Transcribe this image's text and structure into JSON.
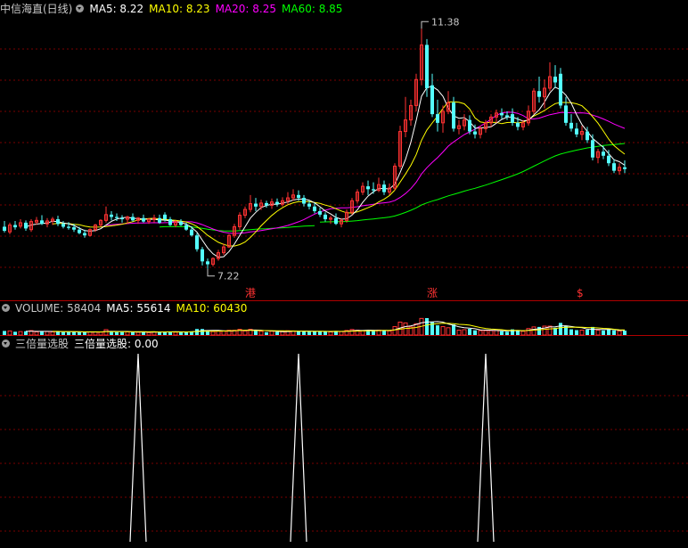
{
  "panels": {
    "price": {
      "stock_name": "中信海直(日线)",
      "ma": [
        {
          "label": "MA5: 8.22",
          "color": "#ffffff"
        },
        {
          "label": "MA10: 8.23",
          "color": "#ffff00"
        },
        {
          "label": "MA20: 8.25",
          "color": "#ff00ff"
        },
        {
          "label": "MA60: 8.85",
          "color": "#00ff00"
        }
      ],
      "high_label": "11.38",
      "low_label": "7.22"
    },
    "volume": {
      "title": "VOLUME: 58404",
      "ma5": "MA5: 55614",
      "ma10": "MA10: 60430"
    },
    "indicator": {
      "name": "三倍量选股",
      "line": "三倍量选股: 0.00"
    }
  },
  "markers": [
    {
      "text": "港",
      "bar": 46
    },
    {
      "text": "涨",
      "bar": 80
    },
    {
      "text": "$",
      "bar": 108
    }
  ],
  "colors": {
    "background": "#000000",
    "up": "#ff3232",
    "down": "#54ffff",
    "grid": "#7a0000",
    "separator": "#b00000",
    "ma5": "#ffffff",
    "ma10": "#ffff00",
    "ma20": "#ff00ff",
    "ma60": "#00ff00"
  },
  "chart_data": {
    "type": "candlestick",
    "price_range": [
      7.0,
      11.6
    ],
    "bars": [
      {
        "o": 7.95,
        "h": 8.05,
        "l": 7.85,
        "c": 7.88
      },
      {
        "o": 7.86,
        "h": 8.02,
        "l": 7.82,
        "c": 7.98
      },
      {
        "o": 7.98,
        "h": 8.05,
        "l": 7.9,
        "c": 7.94
      },
      {
        "o": 7.96,
        "h": 8.08,
        "l": 7.92,
        "c": 8.02
      },
      {
        "o": 8.02,
        "h": 8.06,
        "l": 7.88,
        "c": 7.92
      },
      {
        "o": 7.9,
        "h": 8.08,
        "l": 7.86,
        "c": 8.04
      },
      {
        "o": 8.03,
        "h": 8.12,
        "l": 7.98,
        "c": 8.06
      },
      {
        "o": 8.06,
        "h": 8.15,
        "l": 7.98,
        "c": 8.0
      },
      {
        "o": 8.0,
        "h": 8.1,
        "l": 7.94,
        "c": 8.05
      },
      {
        "o": 8.05,
        "h": 8.12,
        "l": 7.98,
        "c": 8.08
      },
      {
        "o": 8.08,
        "h": 8.14,
        "l": 7.96,
        "c": 8.0
      },
      {
        "o": 8.0,
        "h": 8.05,
        "l": 7.92,
        "c": 7.95
      },
      {
        "o": 7.95,
        "h": 8.03,
        "l": 7.9,
        "c": 7.93
      },
      {
        "o": 7.94,
        "h": 8.0,
        "l": 7.86,
        "c": 7.9
      },
      {
        "o": 7.9,
        "h": 7.95,
        "l": 7.82,
        "c": 7.84
      },
      {
        "o": 7.84,
        "h": 7.9,
        "l": 7.76,
        "c": 7.8
      },
      {
        "o": 7.8,
        "h": 7.92,
        "l": 7.78,
        "c": 7.9
      },
      {
        "o": 7.9,
        "h": 8.0,
        "l": 7.86,
        "c": 7.98
      },
      {
        "o": 7.98,
        "h": 8.08,
        "l": 7.95,
        "c": 8.06
      },
      {
        "o": 8.06,
        "h": 8.3,
        "l": 8.02,
        "c": 8.16
      },
      {
        "o": 8.16,
        "h": 8.22,
        "l": 8.06,
        "c": 8.12
      },
      {
        "o": 8.12,
        "h": 8.18,
        "l": 8.05,
        "c": 8.1
      },
      {
        "o": 8.1,
        "h": 8.15,
        "l": 8.02,
        "c": 8.08
      },
      {
        "o": 8.08,
        "h": 8.14,
        "l": 8.0,
        "c": 8.12
      },
      {
        "o": 8.12,
        "h": 8.18,
        "l": 8.04,
        "c": 8.06
      },
      {
        "o": 8.06,
        "h": 8.12,
        "l": 8.0,
        "c": 8.1
      },
      {
        "o": 8.1,
        "h": 8.16,
        "l": 8.02,
        "c": 8.04
      },
      {
        "o": 8.04,
        "h": 8.1,
        "l": 8.0,
        "c": 8.08
      },
      {
        "o": 8.08,
        "h": 8.16,
        "l": 8.02,
        "c": 8.1
      },
      {
        "o": 8.1,
        "h": 8.16,
        "l": 8.0,
        "c": 8.02
      },
      {
        "o": 8.16,
        "h": 8.2,
        "l": 8.04,
        "c": 8.08
      },
      {
        "o": 8.08,
        "h": 8.12,
        "l": 7.96,
        "c": 7.98
      },
      {
        "o": 7.98,
        "h": 8.06,
        "l": 7.94,
        "c": 8.04
      },
      {
        "o": 8.04,
        "h": 8.08,
        "l": 7.96,
        "c": 7.98
      },
      {
        "o": 7.98,
        "h": 8.02,
        "l": 7.88,
        "c": 7.9
      },
      {
        "o": 7.9,
        "h": 7.96,
        "l": 7.78,
        "c": 7.8
      },
      {
        "o": 7.8,
        "h": 7.84,
        "l": 7.52,
        "c": 7.56
      },
      {
        "o": 7.56,
        "h": 7.6,
        "l": 7.28,
        "c": 7.35
      },
      {
        "o": 7.35,
        "h": 7.4,
        "l": 7.22,
        "c": 7.3
      },
      {
        "o": 7.3,
        "h": 7.42,
        "l": 7.26,
        "c": 7.4
      },
      {
        "o": 7.4,
        "h": 7.55,
        "l": 7.36,
        "c": 7.5
      },
      {
        "o": 7.5,
        "h": 7.66,
        "l": 7.46,
        "c": 7.6
      },
      {
        "o": 7.6,
        "h": 7.82,
        "l": 7.58,
        "c": 7.8
      },
      {
        "o": 7.8,
        "h": 8.0,
        "l": 7.76,
        "c": 7.95
      },
      {
        "o": 7.95,
        "h": 8.2,
        "l": 7.9,
        "c": 8.15
      },
      {
        "o": 8.15,
        "h": 8.3,
        "l": 8.1,
        "c": 8.25
      },
      {
        "o": 8.25,
        "h": 8.5,
        "l": 8.2,
        "c": 8.35
      },
      {
        "o": 8.35,
        "h": 8.45,
        "l": 8.22,
        "c": 8.3
      },
      {
        "o": 8.3,
        "h": 8.42,
        "l": 8.24,
        "c": 8.36
      },
      {
        "o": 8.36,
        "h": 8.4,
        "l": 8.28,
        "c": 8.32
      },
      {
        "o": 8.32,
        "h": 8.44,
        "l": 8.26,
        "c": 8.38
      },
      {
        "o": 8.38,
        "h": 8.44,
        "l": 8.3,
        "c": 8.34
      },
      {
        "o": 8.34,
        "h": 8.46,
        "l": 8.3,
        "c": 8.4
      },
      {
        "o": 8.4,
        "h": 8.55,
        "l": 8.34,
        "c": 8.45
      },
      {
        "o": 8.45,
        "h": 8.6,
        "l": 8.4,
        "c": 8.5
      },
      {
        "o": 8.5,
        "h": 8.58,
        "l": 8.4,
        "c": 8.45
      },
      {
        "o": 8.45,
        "h": 8.5,
        "l": 8.3,
        "c": 8.35
      },
      {
        "o": 8.35,
        "h": 8.4,
        "l": 8.25,
        "c": 8.3
      },
      {
        "o": 8.3,
        "h": 8.36,
        "l": 8.18,
        "c": 8.22
      },
      {
        "o": 8.22,
        "h": 8.28,
        "l": 8.12,
        "c": 8.16
      },
      {
        "o": 8.16,
        "h": 8.2,
        "l": 8.04,
        "c": 8.08
      },
      {
        "o": 8.08,
        "h": 8.14,
        "l": 8.0,
        "c": 8.1
      },
      {
        "o": 8.1,
        "h": 8.18,
        "l": 7.98,
        "c": 8.0
      },
      {
        "o": 8.0,
        "h": 8.1,
        "l": 7.94,
        "c": 8.06
      },
      {
        "o": 8.06,
        "h": 8.25,
        "l": 8.02,
        "c": 8.2
      },
      {
        "o": 8.2,
        "h": 8.45,
        "l": 8.16,
        "c": 8.4
      },
      {
        "o": 8.4,
        "h": 8.6,
        "l": 8.35,
        "c": 8.55
      },
      {
        "o": 8.55,
        "h": 8.72,
        "l": 8.5,
        "c": 8.65
      },
      {
        "o": 8.65,
        "h": 8.75,
        "l": 8.5,
        "c": 8.6
      },
      {
        "o": 8.6,
        "h": 8.72,
        "l": 8.52,
        "c": 8.58
      },
      {
        "o": 8.58,
        "h": 8.8,
        "l": 8.55,
        "c": 8.68
      },
      {
        "o": 8.68,
        "h": 8.75,
        "l": 8.5,
        "c": 8.55
      },
      {
        "o": 8.55,
        "h": 8.7,
        "l": 8.5,
        "c": 8.62
      },
      {
        "o": 8.62,
        "h": 9.05,
        "l": 8.58,
        "c": 9.0
      },
      {
        "o": 9.0,
        "h": 9.7,
        "l": 8.95,
        "c": 9.6
      },
      {
        "o": 9.6,
        "h": 10.2,
        "l": 9.5,
        "c": 9.8
      },
      {
        "o": 9.8,
        "h": 10.15,
        "l": 9.7,
        "c": 10.05
      },
      {
        "o": 10.05,
        "h": 10.6,
        "l": 9.95,
        "c": 10.5
      },
      {
        "o": 10.5,
        "h": 11.38,
        "l": 10.4,
        "c": 11.1
      },
      {
        "o": 11.1,
        "h": 11.2,
        "l": 10.2,
        "c": 10.35
      },
      {
        "o": 10.4,
        "h": 10.6,
        "l": 9.85,
        "c": 9.9
      },
      {
        "o": 9.9,
        "h": 10.15,
        "l": 9.6,
        "c": 9.75
      },
      {
        "o": 9.75,
        "h": 10.05,
        "l": 9.58,
        "c": 9.95
      },
      {
        "o": 9.95,
        "h": 10.3,
        "l": 9.9,
        "c": 10.1
      },
      {
        "o": 10.1,
        "h": 10.2,
        "l": 9.6,
        "c": 9.65
      },
      {
        "o": 9.65,
        "h": 9.8,
        "l": 9.55,
        "c": 9.7
      },
      {
        "o": 9.7,
        "h": 9.9,
        "l": 9.62,
        "c": 9.8
      },
      {
        "o": 9.8,
        "h": 9.88,
        "l": 9.55,
        "c": 9.6
      },
      {
        "o": 9.6,
        "h": 9.72,
        "l": 9.48,
        "c": 9.55
      },
      {
        "o": 9.55,
        "h": 9.7,
        "l": 9.48,
        "c": 9.65
      },
      {
        "o": 9.65,
        "h": 9.8,
        "l": 9.58,
        "c": 9.75
      },
      {
        "o": 9.75,
        "h": 9.9,
        "l": 9.68,
        "c": 9.85
      },
      {
        "o": 9.85,
        "h": 9.98,
        "l": 9.75,
        "c": 9.92
      },
      {
        "o": 9.92,
        "h": 10.0,
        "l": 9.82,
        "c": 9.88
      },
      {
        "o": 9.88,
        "h": 9.95,
        "l": 9.8,
        "c": 9.85
      },
      {
        "o": 9.9,
        "h": 10.0,
        "l": 9.7,
        "c": 9.75
      },
      {
        "o": 9.75,
        "h": 9.85,
        "l": 9.62,
        "c": 9.68
      },
      {
        "o": 9.68,
        "h": 9.8,
        "l": 9.62,
        "c": 9.75
      },
      {
        "o": 9.75,
        "h": 10.05,
        "l": 9.7,
        "c": 9.95
      },
      {
        "o": 9.95,
        "h": 10.35,
        "l": 9.9,
        "c": 10.3
      },
      {
        "o": 10.3,
        "h": 10.55,
        "l": 10.1,
        "c": 10.2
      },
      {
        "o": 10.2,
        "h": 10.5,
        "l": 10.0,
        "c": 10.35
      },
      {
        "o": 10.35,
        "h": 10.8,
        "l": 10.3,
        "c": 10.55
      },
      {
        "o": 10.55,
        "h": 10.75,
        "l": 10.35,
        "c": 10.45
      },
      {
        "o": 10.6,
        "h": 10.7,
        "l": 10.0,
        "c": 10.05
      },
      {
        "o": 10.05,
        "h": 10.2,
        "l": 9.7,
        "c": 9.75
      },
      {
        "o": 9.75,
        "h": 9.9,
        "l": 9.6,
        "c": 9.65
      },
      {
        "o": 9.65,
        "h": 9.75,
        "l": 9.5,
        "c": 9.55
      },
      {
        "o": 9.55,
        "h": 9.7,
        "l": 9.45,
        "c": 9.6
      },
      {
        "o": 9.6,
        "h": 9.68,
        "l": 9.4,
        "c": 9.45
      },
      {
        "o": 9.45,
        "h": 9.55,
        "l": 9.1,
        "c": 9.15
      },
      {
        "o": 9.15,
        "h": 9.3,
        "l": 9.05,
        "c": 9.25
      },
      {
        "o": 9.25,
        "h": 9.35,
        "l": 9.12,
        "c": 9.18
      },
      {
        "o": 9.18,
        "h": 9.28,
        "l": 9.0,
        "c": 9.05
      },
      {
        "o": 9.05,
        "h": 9.12,
        "l": 8.88,
        "c": 8.92
      },
      {
        "o": 8.92,
        "h": 9.05,
        "l": 8.85,
        "c": 8.98
      },
      {
        "o": 8.98,
        "h": 9.1,
        "l": 8.88,
        "c": 8.95
      }
    ],
    "spikes": [
      {
        "bar": 25,
        "level": 1
      },
      {
        "bar": 55,
        "level": 1
      },
      {
        "bar": 90,
        "level": 1
      }
    ]
  }
}
